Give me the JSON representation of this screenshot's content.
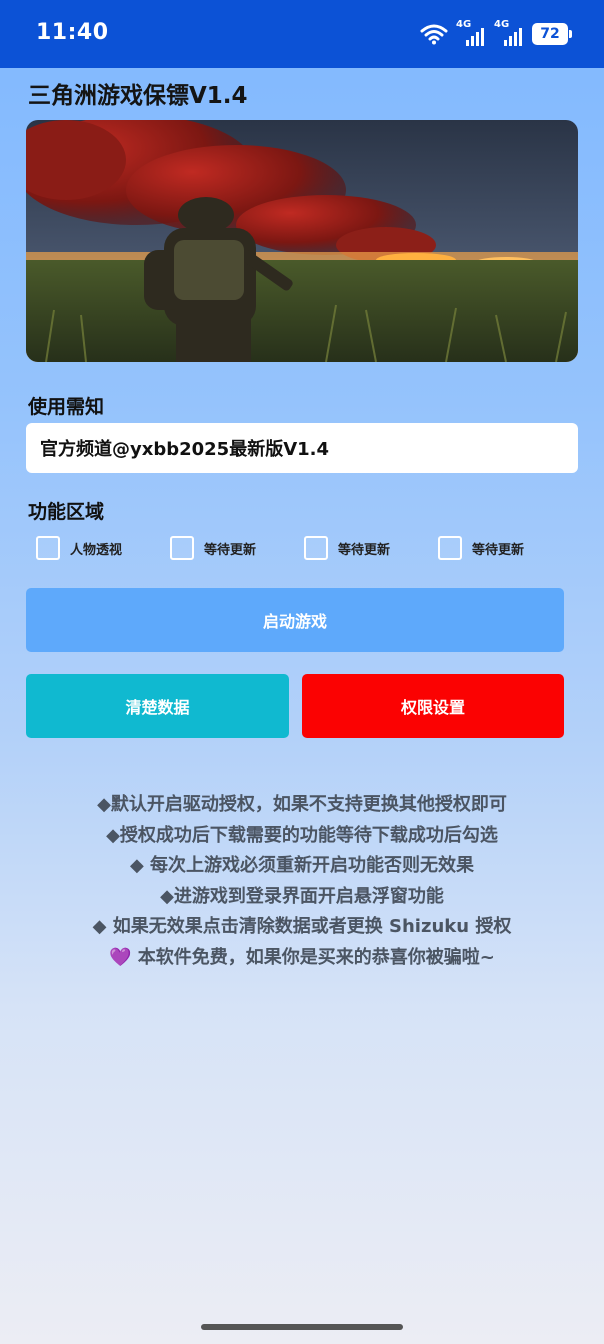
{
  "status_bar": {
    "time": "11:40",
    "network1": "4G",
    "network2": "4G",
    "battery": "72"
  },
  "app": {
    "title": "三角洲游戏保镖V1.4"
  },
  "notice": {
    "label": "使用需知",
    "value": "官方频道@yxbb2025最新版V1.4"
  },
  "features": {
    "label": "功能区域",
    "options": [
      {
        "label": "人物透视",
        "checked": false
      },
      {
        "label": "等待更新",
        "checked": false
      },
      {
        "label": "等待更新",
        "checked": false
      },
      {
        "label": "等待更新",
        "checked": false
      }
    ]
  },
  "buttons": {
    "launch": "启动游戏",
    "clear": "清楚数据",
    "permission": "权限设置"
  },
  "notes": [
    "◆默认开启驱动授权，如果不支持更换其他授权即可",
    "◆授权成功后下载需要的功能等待下载成功后勾选",
    "◆ 每次上游戏必须重新开启功能否则无效果",
    "◆进游戏到登录界面开启悬浮窗功能",
    "◆ 如果无效果点击清除数据或者更换 Shizuku 授权",
    "💜 本软件免费，如果你是买来的恭喜你被骗啦~"
  ],
  "colors": {
    "status_bar": "#0c52d6",
    "launch_button": "#5ea9fb",
    "clear_button": "#10b9d0",
    "permission_button": "#fb0202"
  },
  "icons": [
    "wifi-icon",
    "signal-icon",
    "battery-icon",
    "checkbox-icon"
  ]
}
